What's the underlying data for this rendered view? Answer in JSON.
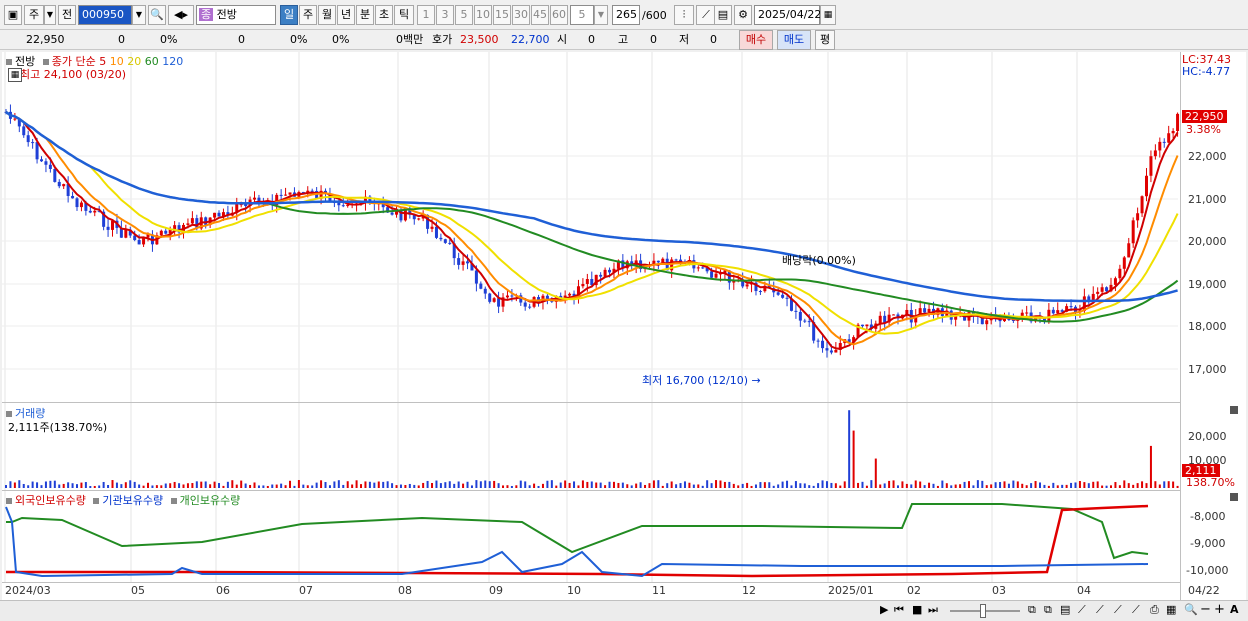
{
  "toolbar": {
    "market_label": "주",
    "prev_label": "전",
    "code": "000950",
    "name": "전방",
    "name_prefix": "종",
    "periods": [
      "일",
      "주",
      "월",
      "년",
      "분",
      "초",
      "틱"
    ],
    "selected_period": "일",
    "ticks": [
      "1",
      "3",
      "5",
      "10",
      "15",
      "30",
      "45",
      "60"
    ],
    "custom_tick": "5",
    "count": "265",
    "count_total": "/600",
    "date": "2025/04/22"
  },
  "infobar": {
    "price": "22,950",
    "change": "0",
    "change_pct": "0%",
    "volume": "0",
    "vol_pct": "0%",
    "pct3": "0%",
    "amount": "0백만",
    "quote_label": "호가",
    "ask": "23,500",
    "bid": "22,700",
    "open_label": "시",
    "open": "0",
    "high_label": "고",
    "high": "0",
    "low_label": "저",
    "low": "0",
    "buy_label": "매수",
    "sell_label": "매도",
    "eval_label": "평"
  },
  "price_pane": {
    "title": "전방",
    "legend_close": "종가 단순",
    "ma_periods": [
      "5",
      "10",
      "20",
      "60",
      "120"
    ],
    "ma_colors": [
      "#d00000",
      "#ff8c00",
      "#f0e000",
      "#228b22",
      "#1f5fd6"
    ],
    "high_note": "최고 24,100 (03/20)",
    "low_note": "최저 16,700 (12/10)",
    "dividend_note": "배당락(0.00%)",
    "lc": "LC:37.43",
    "hc": "HC:-4.77",
    "last_price": "22,950",
    "last_pct": "3.38%",
    "y_ticks": [
      "22,000",
      "21,000",
      "20,000",
      "19,000",
      "18,000",
      "17,000"
    ]
  },
  "volume_pane": {
    "title": "거래량",
    "value_note": "2,111주(138.70%)",
    "y_ticks": [
      "20,000",
      "10,000"
    ],
    "last_vol": "2,111",
    "last_pct": "138.70%"
  },
  "holding_pane": {
    "legend": [
      "외국인보유수량",
      "기관보유수량",
      "개인보유수량"
    ],
    "legend_colors": [
      "#d00000",
      "#0033cc",
      "#228b22"
    ],
    "y_ticks": [
      "-8,000",
      "-9,000",
      "-10,000"
    ]
  },
  "x_axis": {
    "labels": [
      "2024/03",
      "05",
      "06",
      "07",
      "08",
      "09",
      "10",
      "11",
      "12",
      "2025/01",
      "02",
      "03",
      "04"
    ],
    "last_date": "04/22"
  },
  "bottom": {
    "zoom_minus": "−",
    "zoom_plus": "+",
    "letter": "A"
  }
}
